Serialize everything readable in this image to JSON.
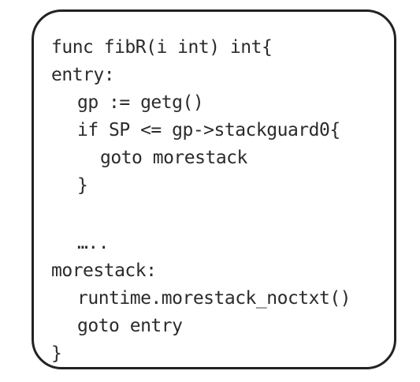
{
  "code": {
    "lines": [
      "func fibR(i int) int{",
      "entry:",
      "gp := getg()",
      "if SP <= gp->stackguard0{",
      "goto morestack",
      "}",
      "",
      "…..",
      "morestack:",
      "runtime.morestack_noctxt()",
      "goto entry",
      "}"
    ]
  },
  "colors": {
    "border": "#222222",
    "text": "#2b2b2b",
    "background": "#ffffff"
  }
}
